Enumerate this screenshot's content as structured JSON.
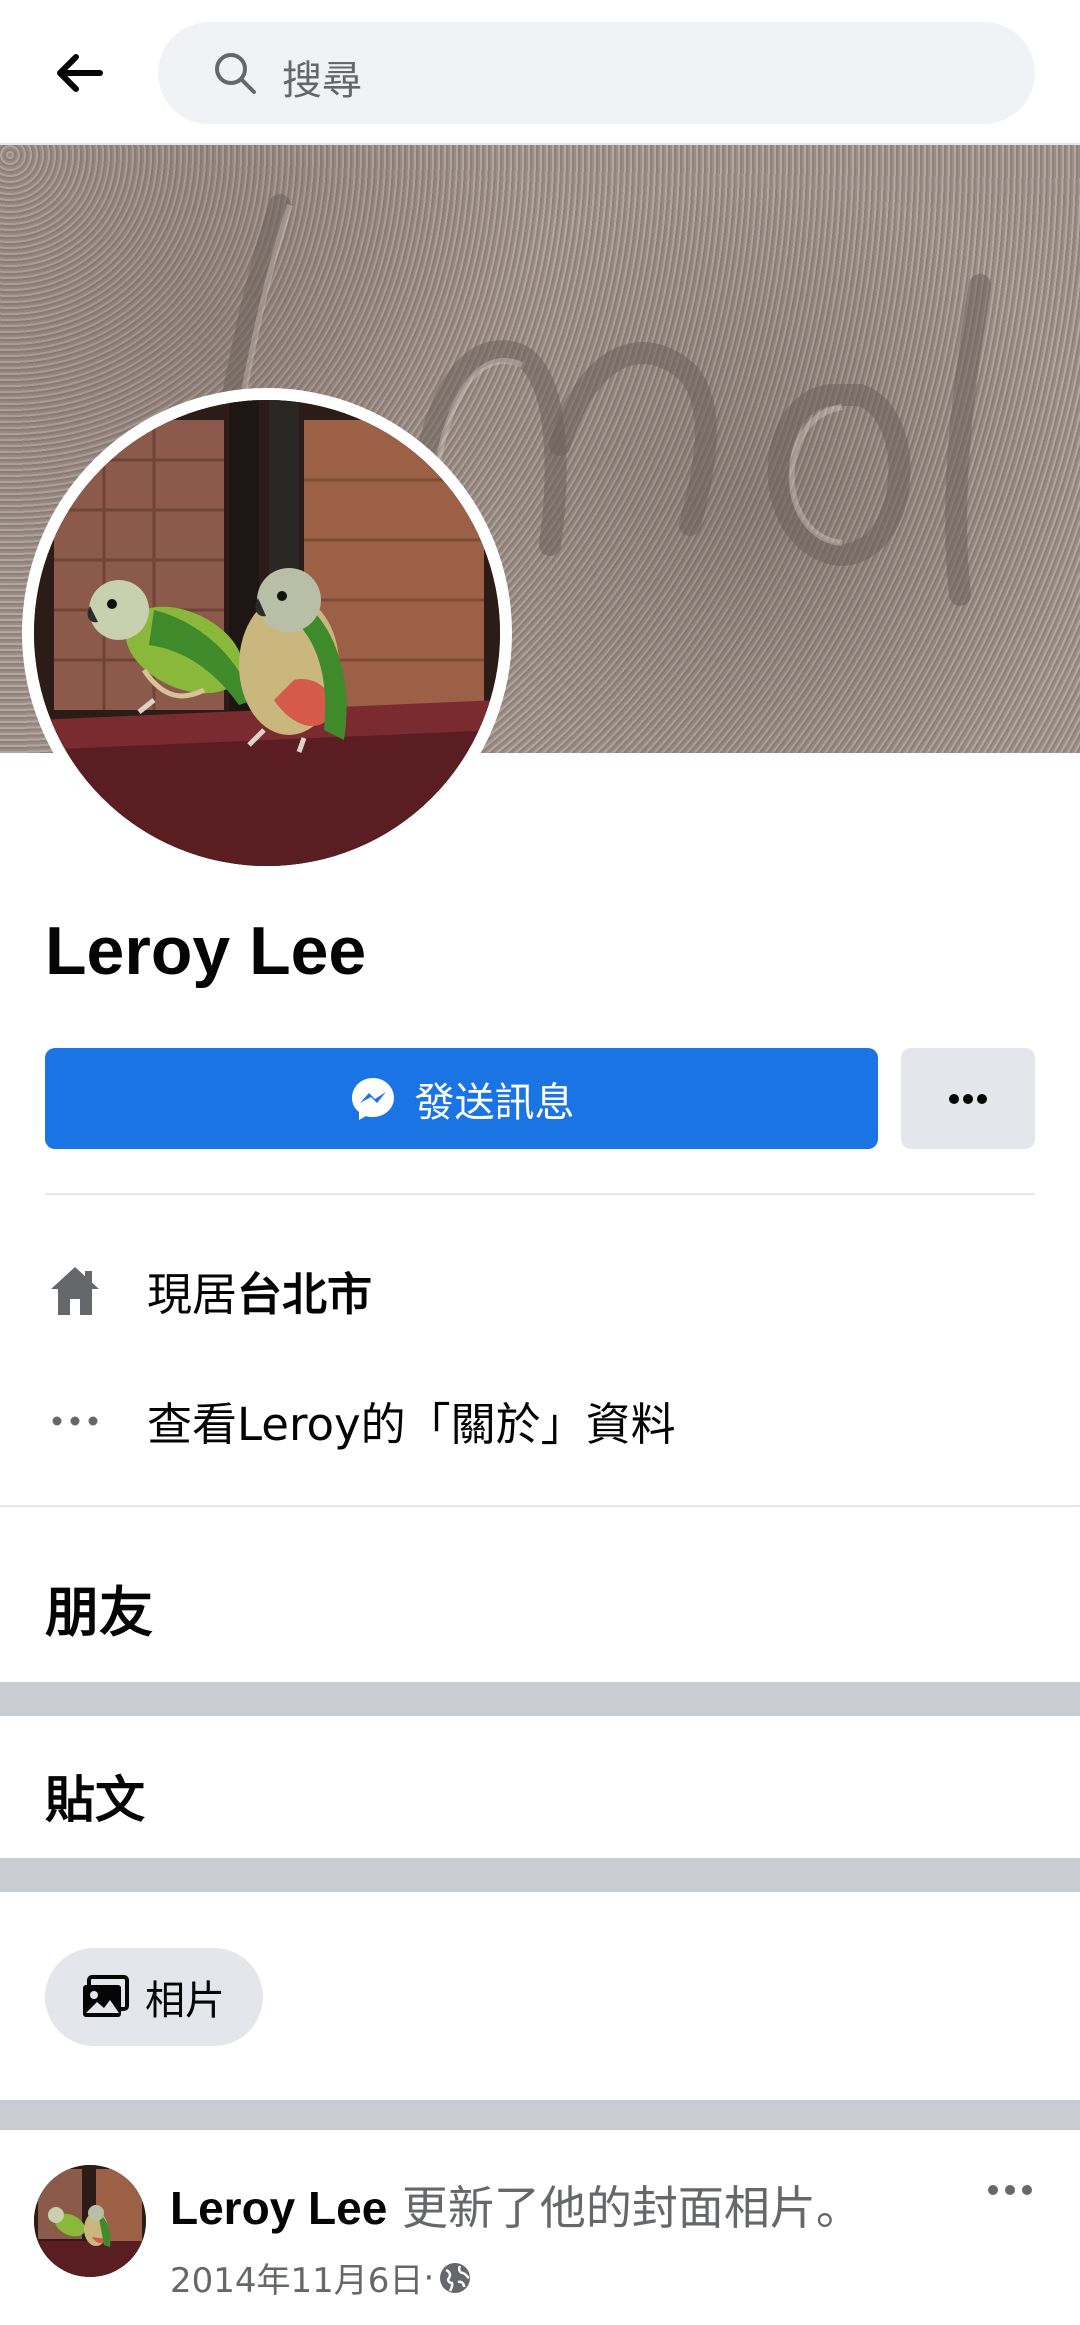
{
  "header": {
    "back_icon": "arrow-left-icon",
    "search_placeholder": "搜尋"
  },
  "profile": {
    "name": "Leroy Lee",
    "send_message_label": "發送訊息",
    "more_icon": "ellipsis-icon"
  },
  "intro": {
    "lives_prefix": "現居",
    "lives_city": "台北市",
    "about_link": "查看Leroy的「關於」資料"
  },
  "sections": {
    "friends_title": "朋友",
    "posts_title": "貼文",
    "photos_chip": "相片"
  },
  "post": {
    "author": "Leroy Lee",
    "action": " 更新了他的封面相片。",
    "date": "2014年11月6日",
    "separator": " · ",
    "privacy_icon": "globe-icon"
  },
  "colors": {
    "accent": "#1b74e4",
    "secondary_text": "#65676b",
    "divider": "#e4e6eb",
    "band": "#c9ccd1"
  }
}
